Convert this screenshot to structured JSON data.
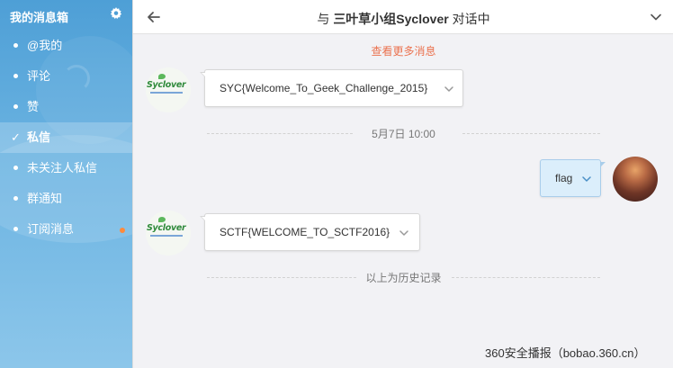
{
  "sidebar": {
    "title": "我的消息箱",
    "gear_icon": "gear-icon",
    "items": [
      {
        "label": "@我的"
      },
      {
        "label": "评论"
      },
      {
        "label": "赞"
      },
      {
        "label": "私信",
        "active": true
      },
      {
        "label": "未关注人私信"
      },
      {
        "label": "群通知"
      },
      {
        "label": "订阅消息",
        "badge_color": "#ff8a3c"
      }
    ]
  },
  "header": {
    "prefix": "与 ",
    "name": "三叶草小组Syclover",
    "suffix": " 对话中",
    "back_icon": "arrow-left-icon",
    "collapse_icon": "chevron-down-icon"
  },
  "chat": {
    "more_messages": "查看更多消息",
    "contact_logo_text": "Syclover",
    "messages": [
      {
        "side": "left",
        "text": "SYC{Welcome_To_Geek_Challenge_2015}"
      },
      {
        "side": "right",
        "text": "flag"
      },
      {
        "side": "left",
        "text": "SCTF{WELCOME_TO_SCTF2016}"
      }
    ],
    "date_divider": "5月7日 10:00",
    "history_divider": "以上为历史记录"
  },
  "watermark": "360安全播报（bobao.360.cn）",
  "colors": {
    "accent_link": "#eb7350",
    "sidebar_blue": "#4e9fd6",
    "own_bubble": "#dbeefb"
  }
}
